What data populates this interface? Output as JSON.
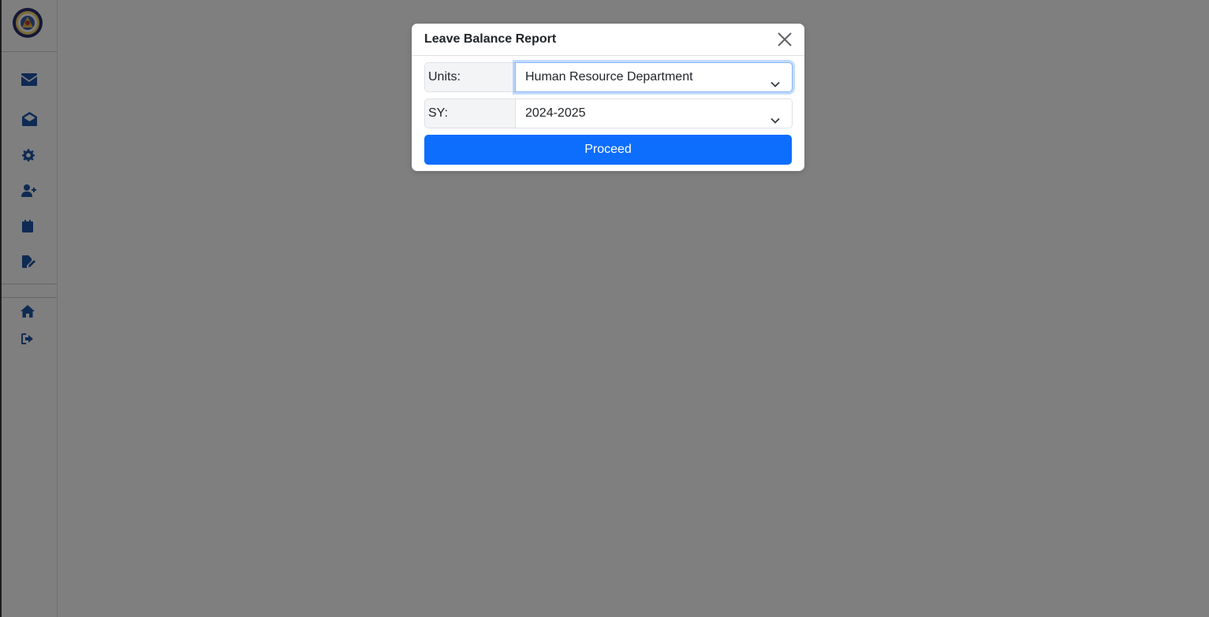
{
  "sidebar": {
    "logo": "institution-seal-logo",
    "icons": [
      {
        "name": "envelope-icon"
      },
      {
        "name": "envelope-open-icon"
      },
      {
        "name": "gear-icon"
      },
      {
        "name": "user-plus-icon"
      },
      {
        "name": "calendar-icon"
      },
      {
        "name": "signature-icon"
      },
      {
        "name": "home-icon"
      },
      {
        "name": "logout-icon"
      }
    ]
  },
  "modal": {
    "title": "Leave Balance Report",
    "units_label": "Units:",
    "units_value": "Human Resource Department",
    "sy_label": "SY:",
    "sy_value": "2024-2025",
    "proceed_label": "Proceed"
  },
  "colors": {
    "primary": "#0d6efd",
    "sidebar_icon": "#1f57a8",
    "backdrop": "#808080"
  }
}
